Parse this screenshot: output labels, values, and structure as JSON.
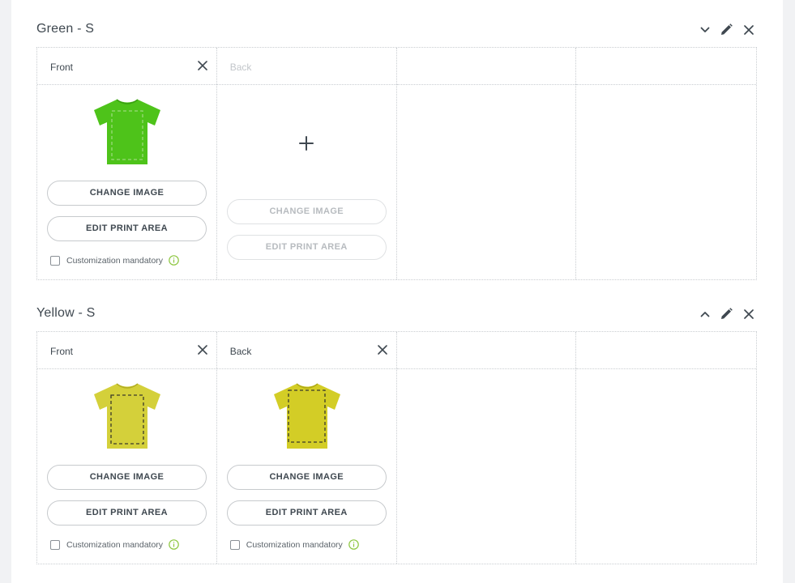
{
  "variants": [
    {
      "title": "Green - S",
      "collapse_icon": "chevron-down-icon",
      "sides": [
        {
          "label": "Front",
          "enabled": true,
          "shirt_color": "#4ec31a",
          "change_image_label": "CHANGE IMAGE",
          "edit_print_area_label": "EDIT PRINT AREA",
          "mandatory_label": "Customization mandatory"
        },
        {
          "label": "Back",
          "enabled": false,
          "change_image_label": "CHANGE IMAGE",
          "edit_print_area_label": "EDIT PRINT AREA"
        }
      ]
    },
    {
      "title": "Yellow - S",
      "collapse_icon": "chevron-up-icon",
      "sides": [
        {
          "label": "Front",
          "enabled": true,
          "shirt_color": "#d4d03a",
          "change_image_label": "CHANGE IMAGE",
          "edit_print_area_label": "EDIT PRINT AREA",
          "mandatory_label": "Customization mandatory"
        },
        {
          "label": "Back",
          "enabled": true,
          "shirt_color": "#d3cd26",
          "change_image_label": "CHANGE IMAGE",
          "edit_print_area_label": "EDIT PRINT AREA",
          "mandatory_label": "Customization mandatory"
        }
      ]
    }
  ],
  "colors": {
    "text": "#3f4850",
    "disabled_text": "#c2c6ca",
    "info_green": "#8dc63f"
  }
}
